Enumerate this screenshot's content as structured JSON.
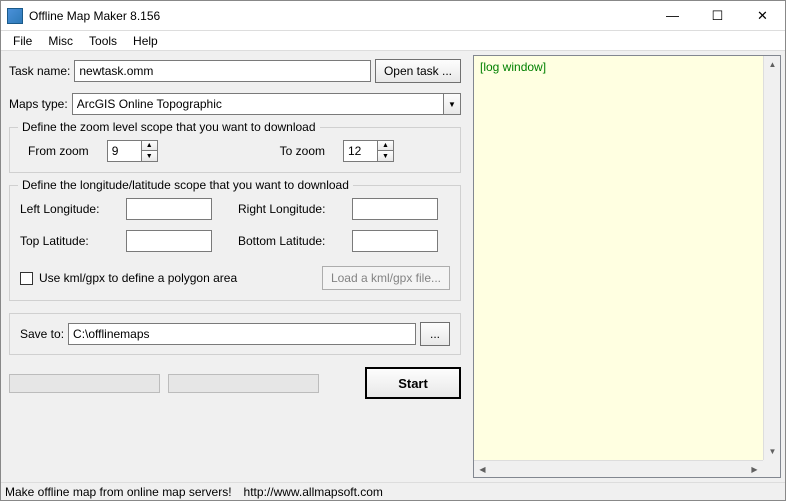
{
  "window": {
    "title": "Offline Map Maker 8.156"
  },
  "menu": {
    "file": "File",
    "misc": "Misc",
    "tools": "Tools",
    "help": "Help"
  },
  "task": {
    "label": "Task name:",
    "value": "newtask.omm",
    "open_btn": "Open task ..."
  },
  "maps": {
    "label": "Maps type:",
    "value": "ArcGIS Online Topographic"
  },
  "zoom_group": {
    "title": "Define the zoom level scope that you want to download",
    "from_label": "From zoom",
    "from_value": "9",
    "to_label": "To zoom",
    "to_value": "12"
  },
  "coord_group": {
    "title": "Define the longitude/latitude scope that you want to download",
    "left_lon_label": "Left Longitude:",
    "left_lon_value": "",
    "right_lon_label": "Right Longitude:",
    "right_lon_value": "",
    "top_lat_label": "Top Latitude:",
    "top_lat_value": "",
    "bottom_lat_label": "Bottom Latitude:",
    "bottom_lat_value": "",
    "kml_checkbox_label": "Use kml/gpx to define a polygon area",
    "kml_btn": "Load a kml/gpx file..."
  },
  "save": {
    "label": "Save to:",
    "value": "C:\\offlinemaps",
    "browse_btn": "..."
  },
  "start_btn": "Start",
  "log": {
    "text": "[log window]"
  },
  "status": {
    "text": "Make offline map from online map servers!",
    "url": "http://www.allmapsoft.com"
  }
}
